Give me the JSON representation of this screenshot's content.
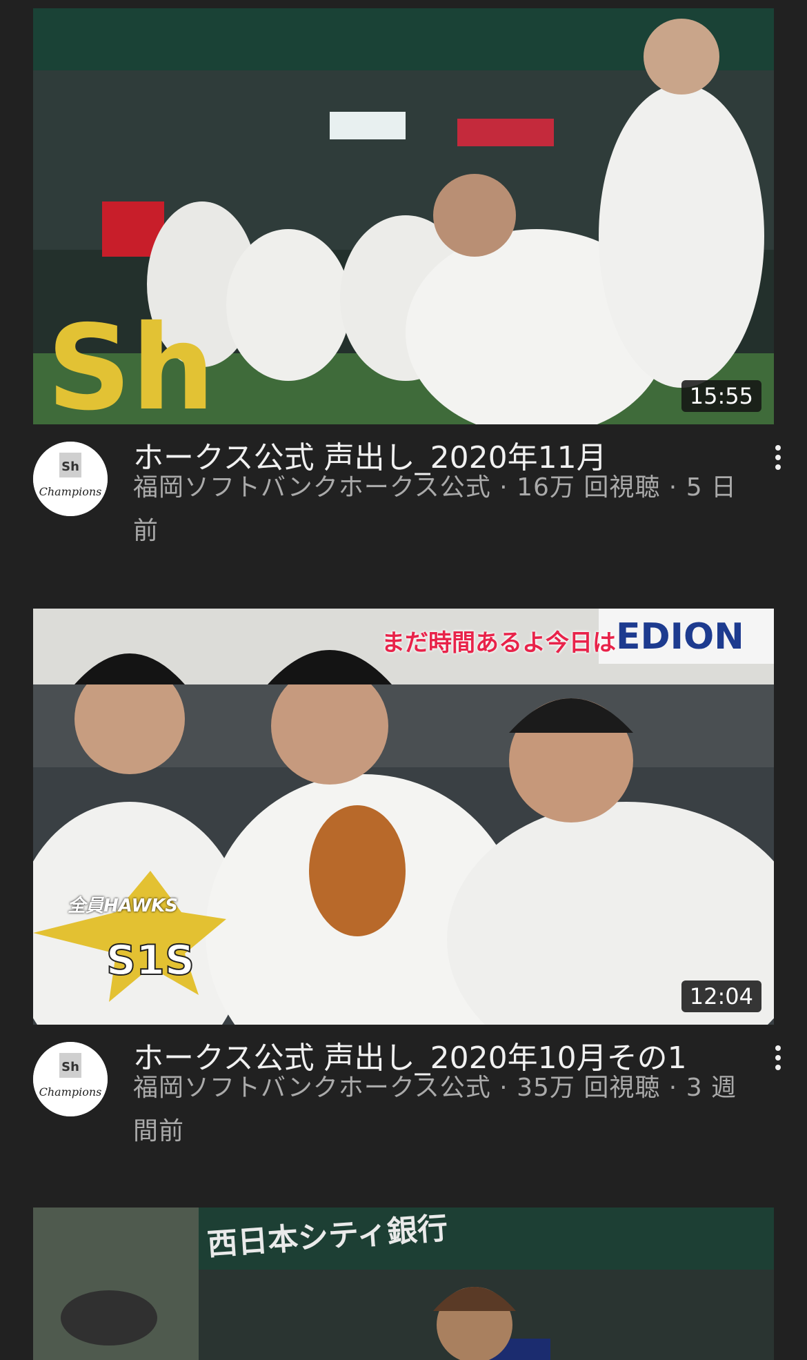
{
  "videos": [
    {
      "title": "ホークス公式 声出し_2020年11月",
      "channel": "福岡ソフトバンクホークス公式",
      "views": "16万 回視聴",
      "age": "5 日前",
      "duration": "15:55",
      "thumbnail_icon": "dugout-huddle-thumbnail",
      "avatar_icon": "champions-logo-icon"
    },
    {
      "title": "ホークス公式 声出し_2020年10月その1",
      "channel": "福岡ソフトバンクホークス公式",
      "views": "35万 回視聴",
      "age": "3 週間前",
      "duration": "12:04",
      "caption_overlay": "まだ時間あるよ今日は",
      "badge_text": "全員HAWKS",
      "thumbnail_icon": "players-glove-thumbnail",
      "avatar_icon": "champions-logo-icon"
    },
    {
      "thumbnail_icon": "stadium-dugout-thumbnail",
      "banner_text": "西日本シティ銀行"
    }
  ],
  "separator": " · ",
  "colors": {
    "background": "#212121",
    "title_text": "#f1f1f1",
    "secondary_text": "#aaaaaa",
    "hawks_yellow": "#f2d230"
  }
}
